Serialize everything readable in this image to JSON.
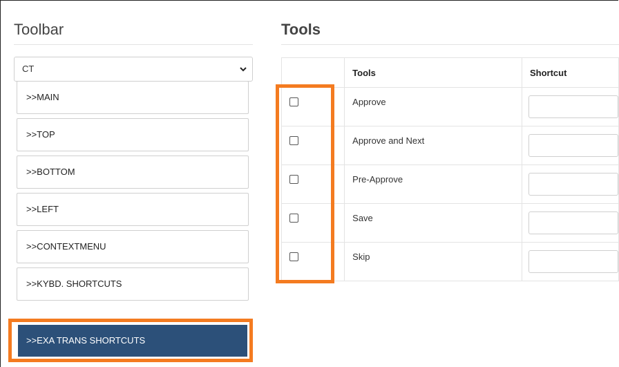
{
  "toolbar": {
    "title": "Toolbar",
    "select_value": "CT",
    "items": [
      {
        "label": ">>MAIN"
      },
      {
        "label": ">>TOP"
      },
      {
        "label": ">>BOTTOM"
      },
      {
        "label": ">>LEFT"
      },
      {
        "label": ">>CONTEXTMENU"
      },
      {
        "label": ">>KYBD. SHORTCUTS"
      },
      {
        "label": ">>EXA TRANS SHORTCUTS"
      }
    ],
    "active_index": 6
  },
  "tools": {
    "title": "Tools",
    "headers": [
      "",
      "Tools",
      "Shortcut"
    ],
    "rows": [
      {
        "name": "Approve",
        "checked": false,
        "shortcut": ""
      },
      {
        "name": "Approve and Next",
        "checked": false,
        "shortcut": ""
      },
      {
        "name": "Pre-Approve",
        "checked": false,
        "shortcut": ""
      },
      {
        "name": "Save",
        "checked": false,
        "shortcut": ""
      },
      {
        "name": "Skip",
        "checked": false,
        "shortcut": ""
      }
    ]
  },
  "colors": {
    "active_nav": "#2c5079",
    "highlight": "#f47b20"
  },
  "icons": {
    "select_chevron": "chevron-down-icon",
    "checkbox": "checkbox-icon"
  }
}
